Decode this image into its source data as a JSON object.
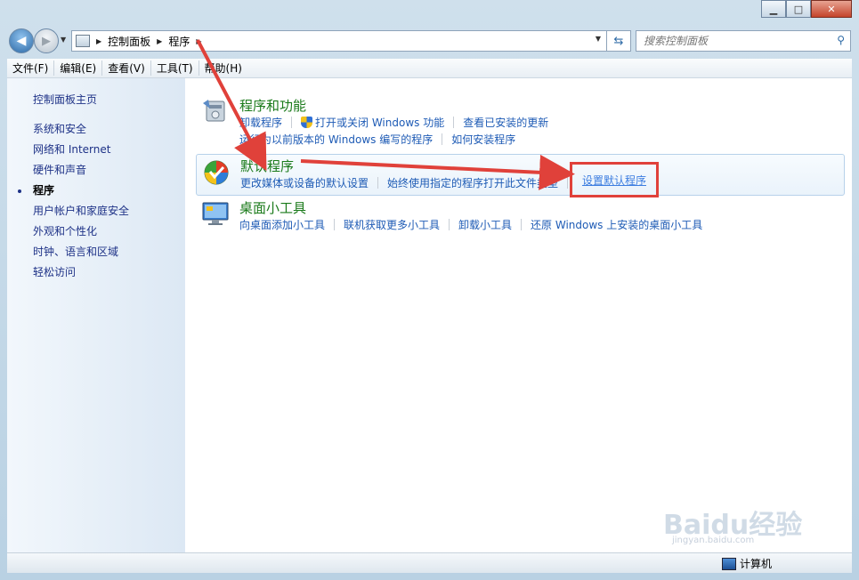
{
  "window": {
    "minimize": "▁",
    "maximize": "□",
    "close": "✕"
  },
  "address": {
    "crumbs": [
      "控制面板",
      "程序"
    ],
    "search_placeholder": "搜索控制面板"
  },
  "menu": [
    "文件(F)",
    "编辑(E)",
    "查看(V)",
    "工具(T)",
    "帮助(H)"
  ],
  "sidebar": {
    "home": "控制面板主页",
    "items": [
      "系统和安全",
      "网络和 Internet",
      "硬件和声音",
      "程序",
      "用户帐户和家庭安全",
      "外观和个性化",
      "时钟、语言和区域",
      "轻松访问"
    ],
    "active_index": 3
  },
  "categories": [
    {
      "title": "程序和功能",
      "icon": "programs-features-icon",
      "rows": [
        [
          "卸载程序",
          "打开或关闭 Windows 功能",
          "查看已安装的更新"
        ],
        [
          "运行为以前版本的 Windows 编写的程序",
          "如何安装程序"
        ]
      ]
    },
    {
      "title": "默认程序",
      "icon": "default-programs-icon",
      "rows": [
        [
          "更改媒体或设备的默认设置",
          "始终使用指定的程序打开此文件类型",
          "设置默认程序"
        ]
      ]
    },
    {
      "title": "桌面小工具",
      "icon": "desktop-gadgets-icon",
      "rows": [
        [
          "向桌面添加小工具",
          "联机获取更多小工具",
          "卸载小工具",
          "还原 Windows 上安装的桌面小工具"
        ]
      ]
    }
  ],
  "statusbar": {
    "computer": "计算机"
  },
  "watermark": {
    "brand": "Baidu经验",
    "site": "jingyan.baidu.com"
  },
  "colors": {
    "link": "#1e5bb5",
    "category_title": "#1a7a1a",
    "annotation": "#e0413a"
  }
}
